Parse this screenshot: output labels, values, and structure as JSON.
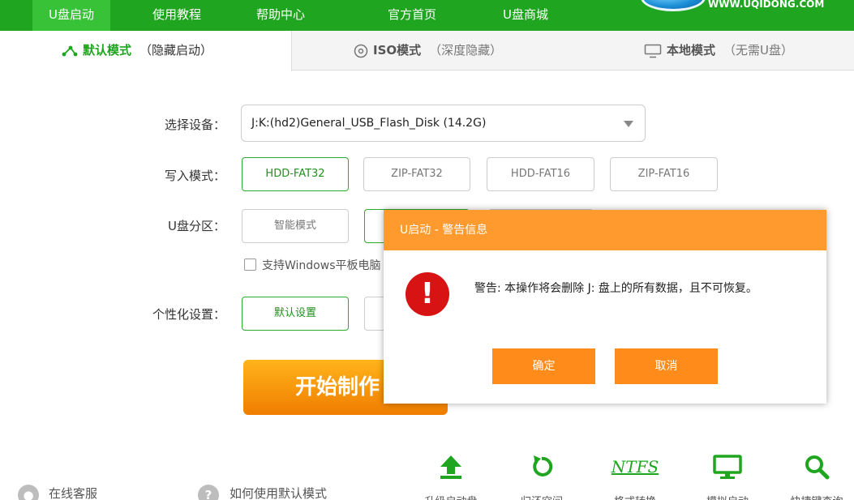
{
  "nav": {
    "tabs": [
      {
        "label": "U盘启动",
        "active": true
      },
      {
        "label": "使用教程",
        "active": false
      },
      {
        "label": "帮助中心",
        "active": false
      },
      {
        "label": "官方首页",
        "active": false
      },
      {
        "label": "U盘商城",
        "active": false
      }
    ],
    "brand_url": "WWW.UQIDONG.COM"
  },
  "modes": [
    {
      "icon": "share-nodes-icon",
      "name": "默认模式",
      "note": "（隐藏启动）",
      "active": true
    },
    {
      "icon": "disc-icon",
      "name": "ISO模式",
      "note": "（深度隐藏）",
      "active": false
    },
    {
      "icon": "monitor-icon",
      "name": "本地模式",
      "note": "（无需U盘）",
      "active": false
    }
  ],
  "form": {
    "device_label": "选择设备：",
    "device_value": "J:K:(hd2)General_USB_Flash_Disk (14.2G)",
    "write_label": "写入模式：",
    "write_options": [
      "HDD-FAT32",
      "ZIP-FAT32",
      "HDD-FAT16",
      "ZIP-FAT16"
    ],
    "write_selected": "HDD-FAT32",
    "partition_label": "U盘分区：",
    "partition_options": [
      "智能模式"
    ],
    "tablet_checkbox_label": "支持Windows平板电脑",
    "personal_label": "个性化设置：",
    "personal_options": [
      "默认设置"
    ],
    "start_label": "开始制作"
  },
  "bottom": {
    "service_label": "在线客服",
    "howto_label": "如何使用默认模式",
    "howto_icon_glyph": "?",
    "tools": [
      {
        "icon": "upload-arrow-icon",
        "label": "升级启动盘"
      },
      {
        "icon": "restore-icon",
        "label": "归还空间"
      },
      {
        "icon": "ntfs-icon",
        "glyph": "NTFS",
        "label": "格式转换"
      },
      {
        "icon": "monitor-icon",
        "label": "模拟启动"
      },
      {
        "icon": "search-icon",
        "label": "快捷键查询"
      }
    ]
  },
  "dialog": {
    "title": "U启动 - 警告信息",
    "icon_glyph": "!",
    "message": "警告: 本操作将会删除 J: 盘上的所有数据，且不可恢复。",
    "ok_label": "确定",
    "cancel_label": "取消"
  },
  "colors": {
    "nav_green": "#1fa51f",
    "active_tab_green": "#37c237",
    "dialog_orange": "#ff9a2e",
    "button_orange": "#ff8c1a",
    "warning_red": "#d81313"
  }
}
